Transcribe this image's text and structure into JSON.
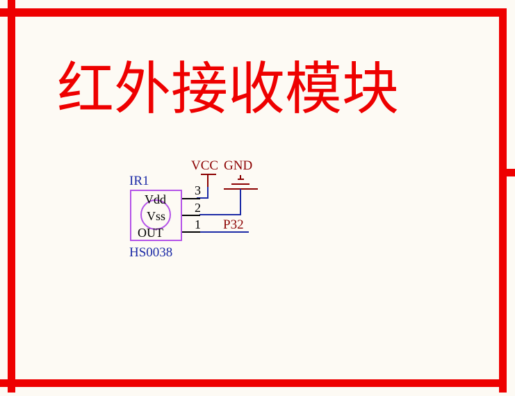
{
  "sheet": {
    "title": "红外接收模块",
    "border_color": "#ee0000",
    "background": "#fdfaf4"
  },
  "component": {
    "designator": "IR1",
    "part_number": "HS0038",
    "body_color": "#b452e8",
    "pin_labels": {
      "vdd": "Vdd",
      "vss": "Vss",
      "out": "OUT"
    },
    "pin_numbers": {
      "vdd": "3",
      "vss": "2",
      "out": "1"
    }
  },
  "power": {
    "vcc_label": "VCC",
    "gnd_label": "GND",
    "color": "#8b0000"
  },
  "nets": {
    "out_net_label": "P32",
    "wire_color": "#1b2aa6"
  }
}
